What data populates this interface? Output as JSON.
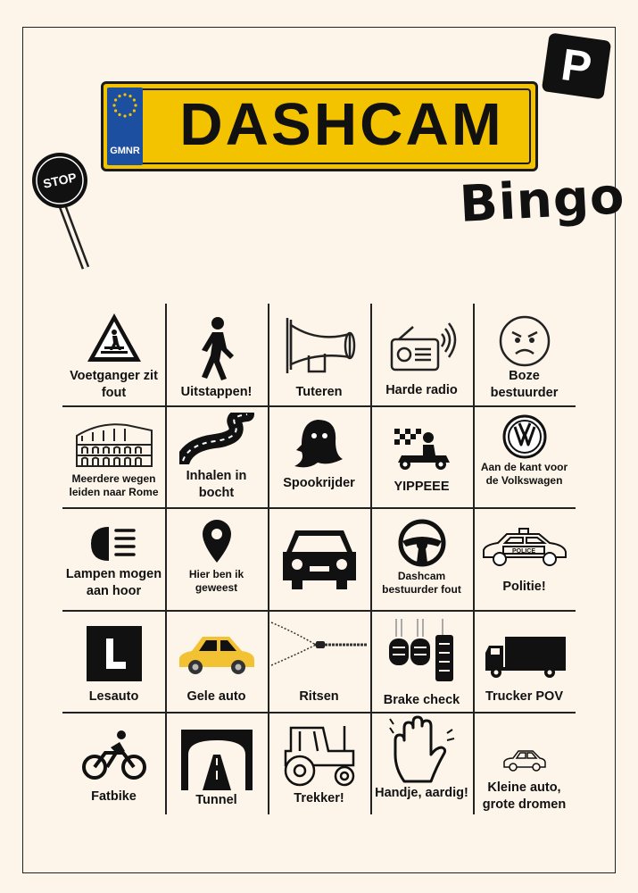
{
  "header": {
    "plate_text": "DASHCAM",
    "plate_country": "GMNR",
    "subtitle": "Bingo",
    "parking_letter": "P",
    "stop_sign": "STOP"
  },
  "cells": [
    {
      "label": "Voetganger zit fout",
      "icon": "pedestrian-crossing-sign-icon"
    },
    {
      "label": "Uitstappen!",
      "icon": "walking-person-icon"
    },
    {
      "label": "Tuteren",
      "icon": "horn-icon"
    },
    {
      "label": "Harde radio",
      "icon": "radio-icon"
    },
    {
      "label": "Boze bestuurder",
      "icon": "angry-face-icon"
    },
    {
      "label": "Meerdere wegen leiden naar Rome",
      "icon": "colosseum-icon"
    },
    {
      "label": "Inhalen in bocht",
      "icon": "curved-road-icon"
    },
    {
      "label": "Spookrijder",
      "icon": "ghost-icon"
    },
    {
      "label": "YIPPEEE",
      "icon": "race-kart-icon"
    },
    {
      "label": "Aan de kant voor de Volkswagen",
      "icon": "volkswagen-logo-icon"
    },
    {
      "label": "Lampen mogen aan hoor",
      "icon": "headlight-icon"
    },
    {
      "label": "Hier ben ik geweest",
      "icon": "map-pin-icon"
    },
    {
      "label": "",
      "icon": "car-front-icon"
    },
    {
      "label": "Dashcam bestuurder fout",
      "icon": "steering-wheel-icon"
    },
    {
      "label": "Politie!",
      "icon": "police-car-icon"
    },
    {
      "label": "Lesauto",
      "icon": "learner-l-sign-icon"
    },
    {
      "label": "Gele auto",
      "icon": "yellow-car-icon"
    },
    {
      "label": "Ritsen",
      "icon": "zipper-icon"
    },
    {
      "label": "Brake check",
      "icon": "car-pedals-icon"
    },
    {
      "label": "Trucker POV",
      "icon": "truck-icon"
    },
    {
      "label": "Fatbike",
      "icon": "cyclist-icon"
    },
    {
      "label": "Tunnel",
      "icon": "tunnel-icon"
    },
    {
      "label": "Trekker!",
      "icon": "tractor-icon"
    },
    {
      "label": "Handje, aardig!",
      "icon": "waving-hand-icon"
    },
    {
      "label": "Kleine auto, grote dromen",
      "icon": "small-car-icon"
    }
  ]
}
